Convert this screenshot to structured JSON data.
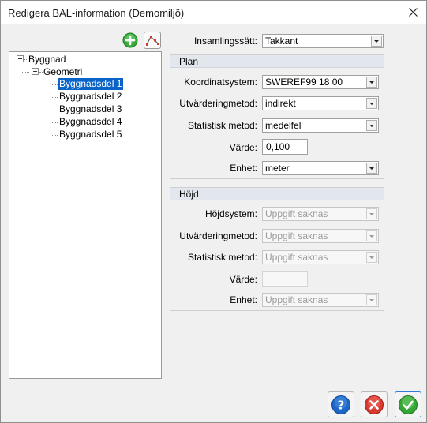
{
  "window": {
    "title": "Redigera BAL-information (Demomiljö)"
  },
  "toolbar": {
    "add_icon": "plus-circle-icon",
    "edit_icon": "polyline-edit-icon"
  },
  "tree": {
    "root": "Byggnad",
    "child": "Geometri",
    "items": [
      "Byggnadsdel 1",
      "Byggnadsdel 2",
      "Byggnadsdel 3",
      "Byggnadsdel 4",
      "Byggnadsdel 5"
    ],
    "selected_index": 0
  },
  "form": {
    "insamlingssatt": {
      "label": "Insamlingssätt:",
      "value": "Takkant"
    },
    "plan": {
      "header": "Plan",
      "koordinatsystem": {
        "label": "Koordinatsystem:",
        "value": "SWEREF99 18 00"
      },
      "utvarderingmetod": {
        "label": "Utvärderingmetod:",
        "value": "indirekt"
      },
      "statistisk_metod": {
        "label": "Statistisk metod:",
        "value": "medelfel"
      },
      "varde": {
        "label": "Värde:",
        "value": "0,100"
      },
      "enhet": {
        "label": "Enhet:",
        "value": "meter"
      }
    },
    "hojd": {
      "header": "Höjd",
      "hojdsystem": {
        "label": "Höjdsystem:",
        "value": "Uppgift saknas"
      },
      "utvarderingmetod": {
        "label": "Utvärderingmetod:",
        "value": "Uppgift saknas"
      },
      "statistisk_metod": {
        "label": "Statistisk metod:",
        "value": "Uppgift saknas"
      },
      "varde": {
        "label": "Värde:",
        "value": ""
      },
      "enhet": {
        "label": "Enhet:",
        "value": "Uppgift saknas"
      }
    }
  },
  "buttons": {
    "help_icon": "help-icon",
    "cancel_icon": "cancel-icon",
    "ok_icon": "ok-check-icon"
  },
  "colors": {
    "selection": "#0a64c8",
    "accent_border": "#2e7bd6",
    "group_header": "#e2e7ee"
  }
}
